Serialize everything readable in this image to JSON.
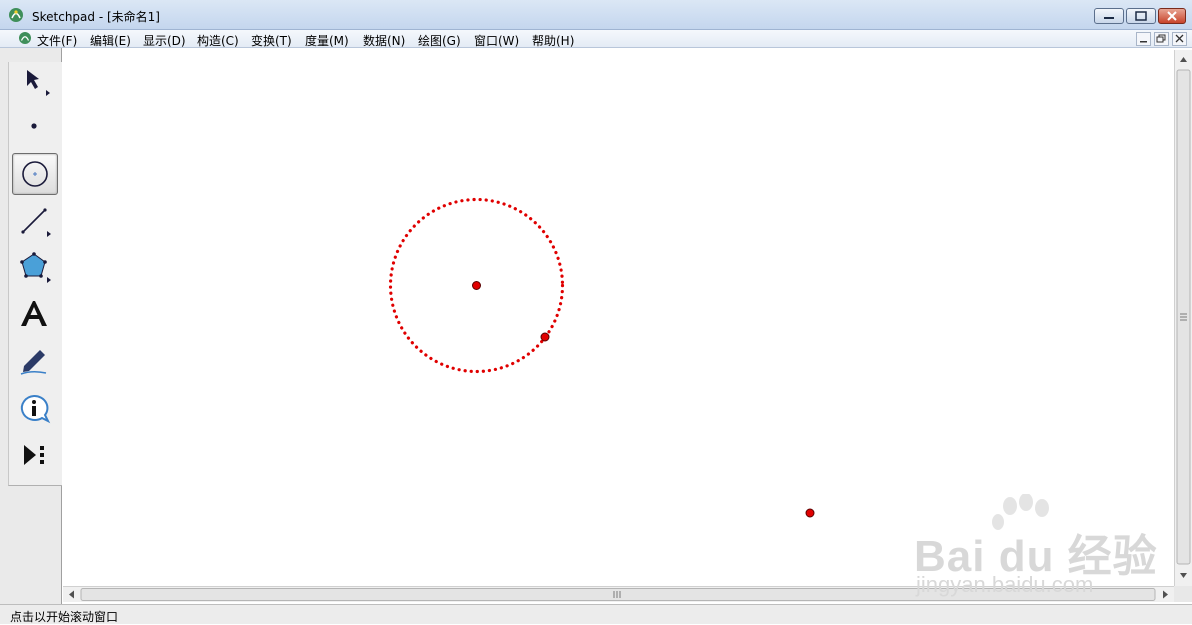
{
  "window": {
    "app_name": "Sketchpad",
    "title": "Sketchpad  - [未命名1]"
  },
  "menu": {
    "items": [
      "文件(F)",
      "编辑(E)",
      "显示(D)",
      "构造(C)",
      "变换(T)",
      "度量(M)",
      "数据(N)",
      "绘图(G)",
      "窗口(W)",
      "帮助(H)"
    ]
  },
  "toolbox": {
    "tools": [
      "arrow-select-tool",
      "point-tool",
      "compass-circle-tool",
      "straightedge-tool",
      "polygon-tool",
      "text-tool",
      "marker-tool",
      "information-tool",
      "custom-tools"
    ],
    "selected": "compass-circle-tool"
  },
  "canvas": {
    "objects": [
      {
        "kind": "circle",
        "style": "dotted",
        "color": "#e00000"
      },
      {
        "kind": "point",
        "role": "circle-center",
        "color": "#e00000"
      },
      {
        "kind": "point",
        "role": "point-on-circle",
        "color": "#e00000"
      },
      {
        "kind": "point",
        "role": "free-point",
        "color": "#e00000"
      }
    ]
  },
  "status": {
    "text": "点击以开始滚动窗口"
  },
  "watermark": {
    "line1": "Bai du 经验",
    "line2": "jingyan.baidu.com"
  },
  "colors": {
    "object_red": "#e00000",
    "titlebar": "#c4d6ee"
  }
}
